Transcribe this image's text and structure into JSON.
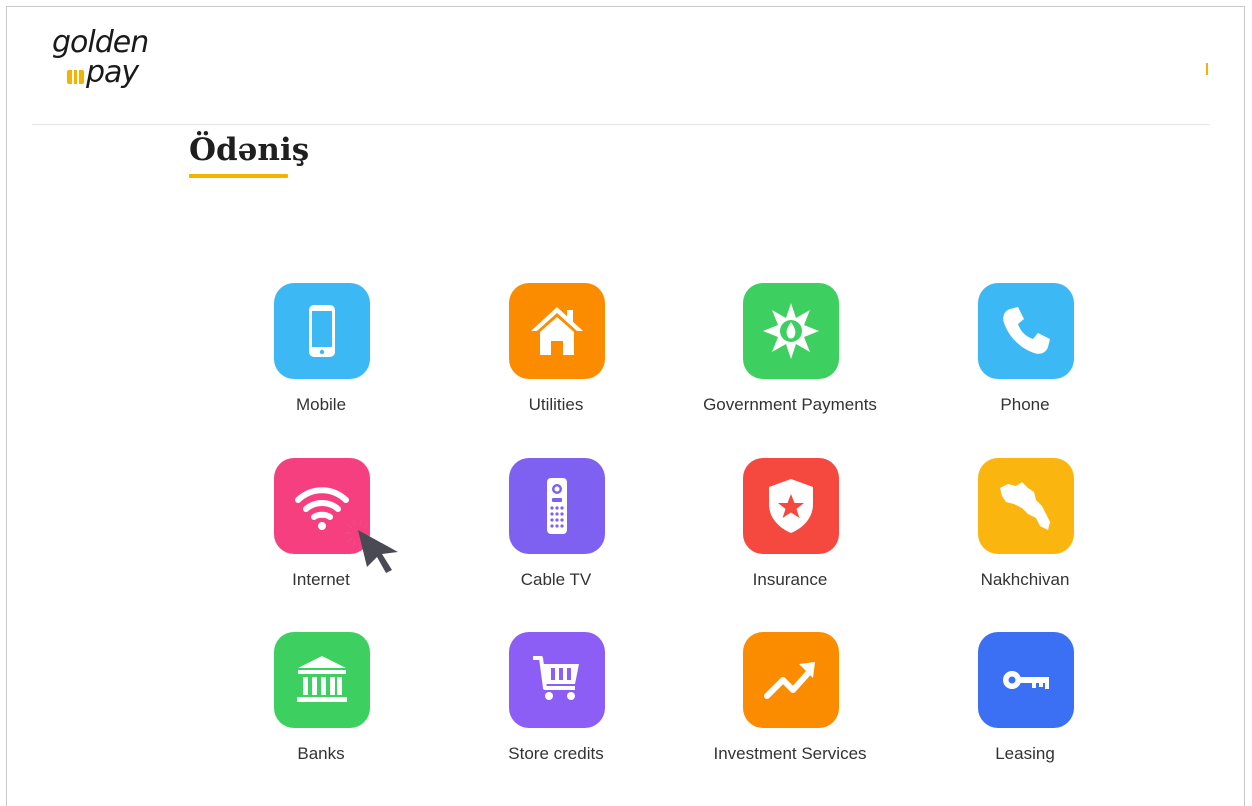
{
  "brand": {
    "line1": "golden",
    "line2": "pay"
  },
  "page": {
    "title": "Ödəniş"
  },
  "categories": [
    {
      "label": "Mobile",
      "icon": "mobile-phone-icon",
      "color": "#3cb9f5"
    },
    {
      "label": "Utilities",
      "icon": "house-icon",
      "color": "#fb8c00"
    },
    {
      "label": "Government Payments",
      "icon": "government-emblem-icon",
      "color": "#3dcf5f"
    },
    {
      "label": "Phone",
      "icon": "telephone-icon",
      "color": "#3cb9f5"
    },
    {
      "label": "Internet",
      "icon": "wifi-icon",
      "color": "#f53f7f"
    },
    {
      "label": "Cable TV",
      "icon": "remote-control-icon",
      "color": "#7e61f0"
    },
    {
      "label": "Insurance",
      "icon": "shield-star-icon",
      "color": "#f5483e"
    },
    {
      "label": "Nakhchivan",
      "icon": "nakhchivan-map-icon",
      "color": "#fbb50f"
    },
    {
      "label": "Banks",
      "icon": "bank-building-icon",
      "color": "#3dcf5f"
    },
    {
      "label": "Store credits",
      "icon": "shopping-cart-icon",
      "color": "#8d5ef5"
    },
    {
      "label": "Investment Services",
      "icon": "trend-up-arrow-icon",
      "color": "#fb8c00"
    },
    {
      "label": "Leasing",
      "icon": "key-icon",
      "color": "#3b6ff4"
    }
  ],
  "accent_color": "#f5b301"
}
